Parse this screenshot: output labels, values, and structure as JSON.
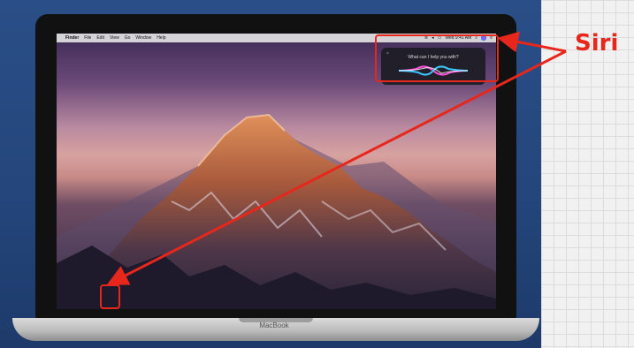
{
  "menubar": {
    "items": [
      "Finder",
      "File",
      "Edit",
      "View",
      "Go",
      "Window",
      "Help"
    ],
    "clock": "Wed 9:41 AM"
  },
  "siri_panel": {
    "question": "What can I help you with?",
    "close": "×"
  },
  "dock": {
    "icons": [
      {
        "name": "finder-icon",
        "color": "#2f8cf0"
      },
      {
        "name": "siri-icon",
        "color": "#5a3cc8"
      },
      {
        "name": "launchpad-icon",
        "color": "#aab4c6"
      },
      {
        "name": "safari-icon",
        "color": "#2e9bf0"
      },
      {
        "name": "mail-icon",
        "color": "#4aa8f2"
      },
      {
        "name": "contacts-icon",
        "color": "#b88a5a"
      },
      {
        "name": "calendar-icon",
        "color": "#f4f4f4"
      },
      {
        "name": "notes-icon",
        "color": "#f3d34a"
      },
      {
        "name": "reminders-icon",
        "color": "#f0f0f0"
      },
      {
        "name": "maps-icon",
        "color": "#5cbf6a"
      },
      {
        "name": "photos-icon",
        "color": "#f07aa8"
      },
      {
        "name": "messages-icon",
        "color": "#3ac95a"
      },
      {
        "name": "facetime-icon",
        "color": "#2fb34e"
      },
      {
        "name": "pages-icon",
        "color": "#f29a30"
      },
      {
        "name": "numbers-icon",
        "color": "#3eb552"
      },
      {
        "name": "keynote-icon",
        "color": "#3f7ee0"
      },
      {
        "name": "itunes-icon",
        "color": "#e84b8e"
      },
      {
        "name": "ibooks-icon",
        "color": "#f28a1e"
      },
      {
        "name": "app-store-icon",
        "color": "#2a8ff0"
      },
      {
        "name": "system-preferences-icon",
        "color": "#8a8f98"
      },
      {
        "name": "folder-icon",
        "color": "#62b1f0"
      },
      {
        "name": "trash-icon",
        "color": "#c9ced6"
      }
    ]
  },
  "laptop": {
    "brand": "MacBook"
  },
  "annotation": {
    "label": "Siri",
    "color": "#e8271c"
  }
}
